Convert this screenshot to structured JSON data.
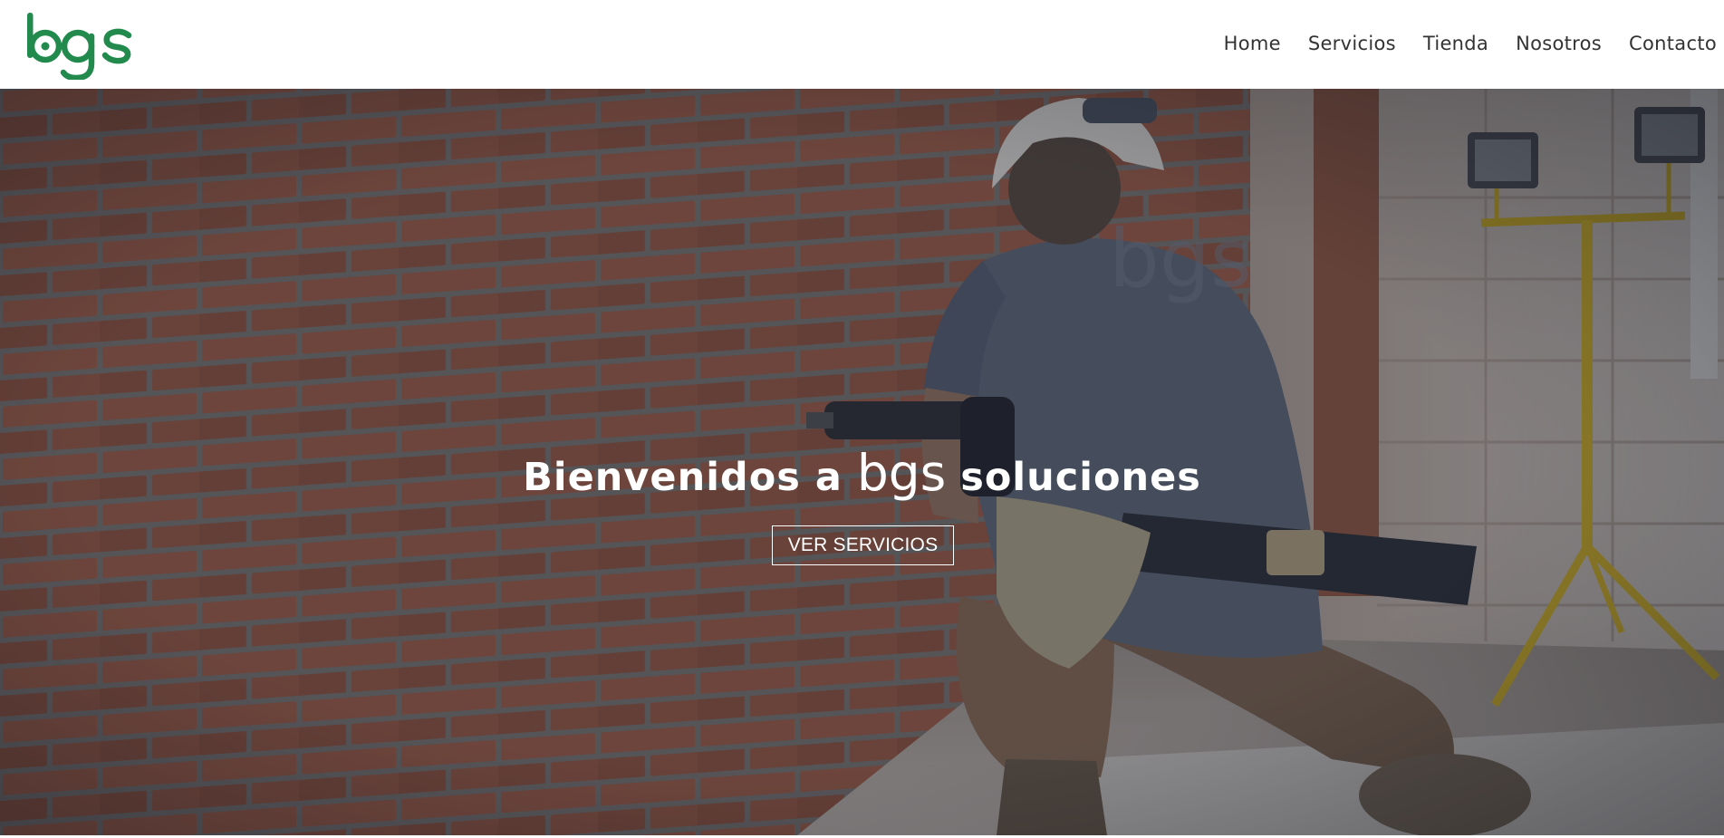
{
  "brand": {
    "logo_text": "bgs",
    "logo_color": "#238a4e"
  },
  "nav": {
    "items": [
      "Home",
      "Servicios",
      "Tienda",
      "Nosotros",
      "Contacto"
    ]
  },
  "hero": {
    "title_before": "Bienvenidos a ",
    "title_brand": "bgs",
    "title_after": " soluciones",
    "cta_label": "VER SERVICIOS",
    "shirt_logo_text": "bgs"
  },
  "colors": {
    "nav_text": "#333333",
    "overlay": "rgba(20,28,48,0.38)",
    "brick": "#9a5a42",
    "cta_border": "#ffffff"
  }
}
